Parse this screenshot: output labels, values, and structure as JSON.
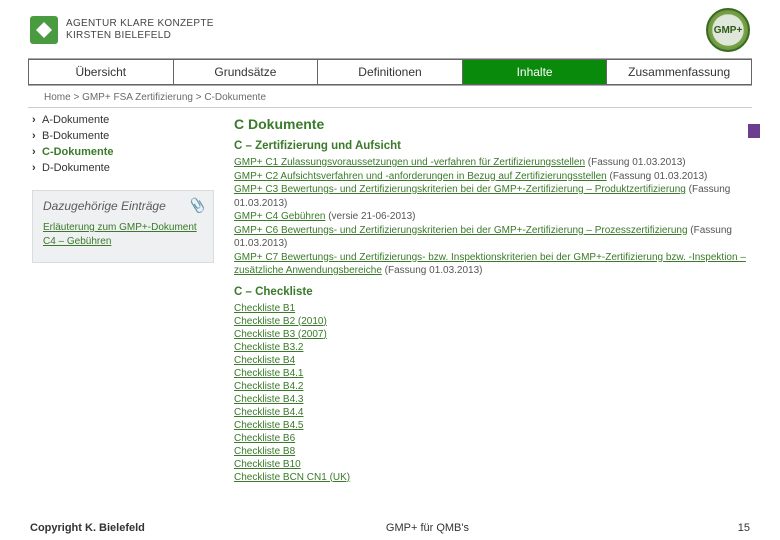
{
  "header": {
    "logo_line1": "Agentur Klare Konzepte",
    "logo_line2": "Kirsten Bielefeld",
    "badge": "GMP+"
  },
  "tabs": {
    "t0": "Übersicht",
    "t1": "Grundsätze",
    "t2": "Definitionen",
    "t3": "Inhalte",
    "t4": "Zusammenfassung"
  },
  "breadcrumb": "Home > GMP+ FSA Zertifizierung > C-Dokumente",
  "sidebar": {
    "items": {
      "a": "A-Dokumente",
      "b": "B-Dokumente",
      "c": "C-Dokumente",
      "d": "D-Dokumente"
    },
    "related_title": "Dazugehörige Einträge",
    "related_link": "Erläuterung zum GMP+-Dokument C4 – Gebühren"
  },
  "main": {
    "h2": "C Dokumente",
    "h3a": "C – Zertifizierung und Aufsicht",
    "c1": {
      "link": "GMP+ C1 Zulassungsvoraussetzungen und -verfahren für Zertifizierungsstellen",
      "note": " (Fassung 01.03.2013)"
    },
    "c2": {
      "link": "GMP+ C2 Aufsichtsverfahren und -anforderungen in Bezug auf Zertifizierungsstellen",
      "note": " (Fassung 01.03.2013)"
    },
    "c3": {
      "link": "GMP+ C3 Bewertungs- und Zertifizierungskriterien bei der GMP+-Zertifizierung – Produktzertifizierung",
      "note": " (Fassung 01.03.2013)"
    },
    "c4": {
      "link": "GMP+ C4 Gebühren",
      "note": " (versie 21-06-2013)"
    },
    "c6": {
      "link": "GMP+ C6 Bewertungs- und Zertifizierungskriterien bei der GMP+-Zertifizierung – Prozesszertifizierung",
      "note": " (Fassung 01.03.2013)"
    },
    "c7": {
      "link": "GMP+ C7 Bewertungs- und Zertifizierungs- bzw. Inspektionskriterien bei der GMP+-Zertifizierung bzw. -Inspektion – zusätzliche Anwendungsbereiche",
      "note": " (Fassung 01.03.2013)"
    },
    "h3b": "C – Checkliste",
    "checklists": {
      "0": "Checkliste B1",
      "1": "Checkliste B2 (2010)",
      "2": "Checkliste B3 (2007)",
      "3": "Checkliste B3.2",
      "4": "Checkliste B4",
      "5": "Checkliste B4.1",
      "6": "Checkliste B4.2",
      "7": "Checkliste B4.3",
      "8": "Checkliste B4.4",
      "9": "Checkliste B4.5",
      "10": "Checkliste B6",
      "11": "Checkliste B8",
      "12": "Checkliste B10",
      "13": "Checkliste BCN CN1 (UK)"
    }
  },
  "footer": {
    "copyright": "Copyright K. Bielefeld",
    "center": "GMP+ für QMB's",
    "page": "15"
  }
}
